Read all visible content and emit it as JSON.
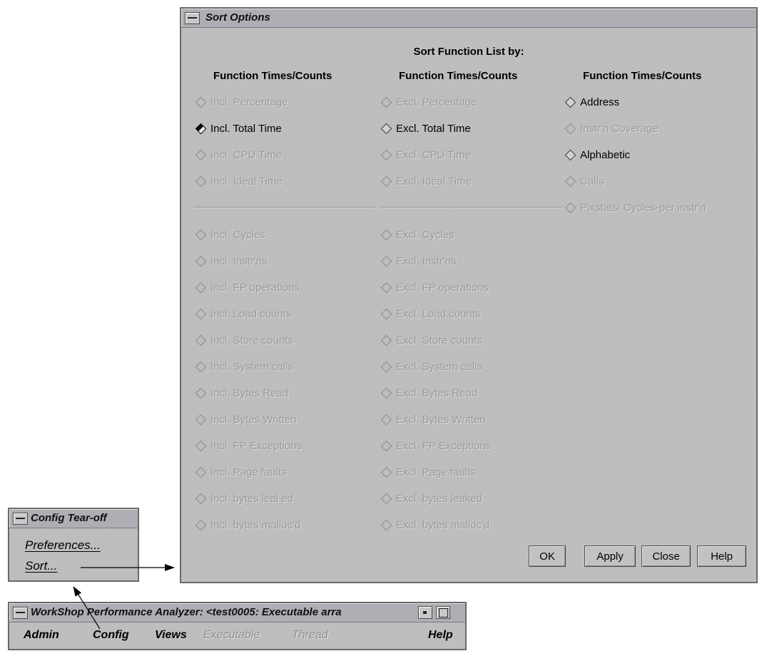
{
  "sort_window": {
    "title": "Sort Options",
    "heading": "Sort Function List by:",
    "columns": [
      {
        "heading": "Function Times/Counts",
        "top_options": [
          {
            "label": "Incl. Percentage",
            "state": "disabled"
          },
          {
            "label": "Incl. Total Time",
            "state": "selected"
          },
          {
            "label": "Incl. CPU Time",
            "state": "disabled"
          },
          {
            "label": "Incl. Ideal Time",
            "state": "disabled"
          }
        ],
        "bottom_options": [
          {
            "label": "Incl. Cycles",
            "state": "disabled"
          },
          {
            "label": "Incl. Instr'ns",
            "state": "disabled"
          },
          {
            "label": "Incl. FP operations",
            "state": "disabled"
          },
          {
            "label": "Incl. Load counts",
            "state": "disabled"
          },
          {
            "label": "Incl. Store counts",
            "state": "disabled"
          },
          {
            "label": "Incl. System calls",
            "state": "disabled"
          },
          {
            "label": "Incl. Bytes Read",
            "state": "disabled"
          },
          {
            "label": "Incl. Bytes Written",
            "state": "disabled"
          },
          {
            "label": "Incl. FP Exceptions",
            "state": "disabled"
          },
          {
            "label": "Incl. Page faults",
            "state": "disabled"
          },
          {
            "label": "Incl. bytes leal ed",
            "state": "disabled"
          },
          {
            "label": "Incl. bytes malloc'd",
            "state": "disabled"
          }
        ]
      },
      {
        "heading": "Function Times/Counts",
        "top_options": [
          {
            "label": "Excl. Percentage",
            "state": "disabled"
          },
          {
            "label": "Excl. Total Time",
            "state": "enabled"
          },
          {
            "label": "Excl. CPU Time",
            "state": "disabled"
          },
          {
            "label": "Excl. Ideal Time",
            "state": "disabled"
          }
        ],
        "bottom_options": [
          {
            "label": "Excl. Cycles",
            "state": "disabled"
          },
          {
            "label": "Excl. Instr'ns",
            "state": "disabled"
          },
          {
            "label": "Excl. FP operations",
            "state": "disabled"
          },
          {
            "label": "Excl. Load counts",
            "state": "disabled"
          },
          {
            "label": "Excl. Store counts",
            "state": "disabled"
          },
          {
            "label": "Excl. System calls",
            "state": "disabled"
          },
          {
            "label": "Excl. Bytes Read",
            "state": "disabled"
          },
          {
            "label": "Excl. Bytes Written",
            "state": "disabled"
          },
          {
            "label": "Excl. FP Exceptions",
            "state": "disabled"
          },
          {
            "label": "Excl. Page faults",
            "state": "disabled"
          },
          {
            "label": "Excl. bytes leaked",
            "state": "disabled"
          },
          {
            "label": "Excl. bytes malloc'd",
            "state": "disabled"
          }
        ]
      },
      {
        "heading": "Function Times/Counts",
        "top_options": [
          {
            "label": "Address",
            "state": "enabled"
          },
          {
            "label": "Instr'n Coverage",
            "state": "disabled"
          },
          {
            "label": "Alphabetic",
            "state": "enabled"
          },
          {
            "label": "Calls",
            "state": "disabled"
          },
          {
            "label": "Pixstats/ Cycles-per instr'n",
            "state": "disabled"
          }
        ],
        "bottom_options": []
      }
    ],
    "buttons": {
      "ok": "OK",
      "apply": "Apply",
      "close": "Close",
      "help": "Help"
    }
  },
  "config_window": {
    "title": "Config Tear-off",
    "items": [
      "Preferences...",
      "Sort..."
    ]
  },
  "analyzer_window": {
    "title": "WorkShop Performance Analyzer: <test0005: Executable arra",
    "menu": [
      {
        "label": "Admin",
        "enabled": true
      },
      {
        "label": "Config",
        "enabled": true
      },
      {
        "label": "Views",
        "enabled": true
      },
      {
        "label": "Executable",
        "enabled": false
      },
      {
        "label": "Thread",
        "enabled": false
      },
      {
        "label": "Help",
        "enabled": true
      }
    ]
  }
}
